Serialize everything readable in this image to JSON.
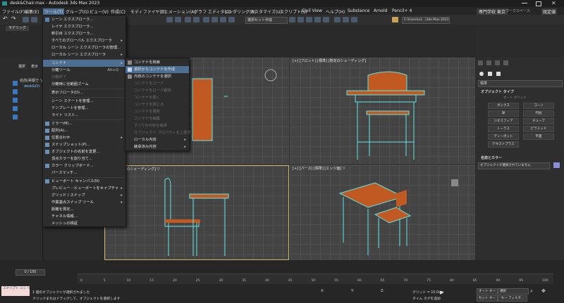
{
  "window": {
    "title": "desk&Chair.max - Autodesk 3ds Max 2023"
  },
  "menubar": {
    "items": [
      "ファイル(F)",
      "編集(E)",
      "ツール(T)",
      "グループ(G)",
      "ビュー(V)",
      "作成(C)",
      "モディファイヤ(O)",
      "アニメーション(A)",
      "グラフ エディタ(D)",
      "レンダリング(R)",
      "カスタマイズ(U)",
      "スクリプト(S)",
      "Civil View",
      "ヘルプ(H)",
      "Substance",
      "Arnold",
      "Pencil+ 4"
    ],
    "workspace": "専門学校 東京",
    "workspace_label": "ワークスペース:",
    "workspace_value": "既定値"
  },
  "toolbar": {
    "select_set": "選択セット作成",
    "path": "C:\\Users\\u1...\\3ds Max 2023"
  },
  "tools_menu": {
    "items": [
      {
        "label": "シーン エクスプローラ...",
        "enabled": true
      },
      {
        "label": "レイヤ エクスプローラ...",
        "enabled": true
      },
      {
        "label": "新引目 エクスプローラ...",
        "enabled": true
      },
      {
        "label": "すべてのグローバル エクスプローラ",
        "enabled": true,
        "submenu": true
      },
      {
        "label": "ローカル シーン エクスプローラの管理...",
        "enabled": true
      },
      {
        "label": "ローカル シーン エクスプローラ",
        "enabled": true,
        "submenu": true
      },
      {
        "label": "コンテナ",
        "enabled": true,
        "submenu": true,
        "highlight": true
      },
      {
        "label": "分離ツール",
        "enabled": true,
        "shortcut": "Alt+Q"
      },
      {
        "label": "分離終了",
        "enabled": false
      },
      {
        "label": "分離時に全範囲ズーム",
        "enabled": true
      },
      {
        "label": "表示フロータ(D)...",
        "enabled": true
      },
      {
        "label": "シーン ステートを管理...",
        "enabled": true
      },
      {
        "label": "テンプレートを管理...",
        "enabled": true
      },
      {
        "label": "ライト リスト...",
        "enabled": true
      },
      {
        "label": "ミラー(M)...",
        "enabled": true
      },
      {
        "label": "配列(A)...",
        "enabled": true
      },
      {
        "label": "位置合わせ",
        "enabled": true,
        "submenu": true
      },
      {
        "label": "スナップショット(P)...",
        "enabled": true
      },
      {
        "label": "オブジェクトの名前を変更...",
        "enabled": true
      },
      {
        "label": "頂点カラーを割り当て...",
        "enabled": true
      },
      {
        "label": "カラー クリップボード...",
        "enabled": true
      },
      {
        "label": "パースマッチ...",
        "enabled": true
      },
      {
        "label": "ビューポート キャンバス(N)",
        "enabled": true
      },
      {
        "label": "プレビュー - ビューポートをキャプチャ",
        "enabled": true,
        "submenu": true
      },
      {
        "label": "グリッド / スナップ",
        "enabled": true,
        "submenu": true
      },
      {
        "label": "作業基点スナップ ツール",
        "enabled": true,
        "submenu": true
      },
      {
        "label": "距離を測定...",
        "enabled": true
      },
      {
        "label": "チャネル情報...",
        "enabled": true
      },
      {
        "label": "メッシュの検証",
        "enabled": true
      }
    ]
  },
  "container_submenu": {
    "items": [
      {
        "label": "コンテナを検索",
        "enabled": true
      },
      {
        "label": "選択からコンテナを作成",
        "enabled": true,
        "highlight": true
      },
      {
        "label": "内容のコンテナを選択",
        "enabled": true
      },
      {
        "label": "コンテナをロード",
        "enabled": false
      },
      {
        "label": "コンテナをロード解除",
        "enabled": false
      },
      {
        "label": "コンテナを開く",
        "enabled": false
      },
      {
        "label": "コンテナを閉じる",
        "enabled": false
      },
      {
        "label": "コンテナを更新",
        "enabled": false
      },
      {
        "label": "コンテナを編集",
        "enabled": false
      },
      {
        "label": "すべての内容を継承",
        "enabled": false
      },
      {
        "label": "オブジェクト プロパティを上書き",
        "enabled": false
      },
      {
        "label": "ローカル内容",
        "enabled": true,
        "submenu": true
      },
      {
        "label": "継承済み内容",
        "enabled": true,
        "submenu": true
      }
    ]
  },
  "viewports": {
    "top_right": "[+] [フロント] [標準] [既定のシェーディング]",
    "bottom_left": "[標準] [既定のシェーディング] ▽",
    "bottom_right": "[+] [パース] [標準] [エッジ面] ▽"
  },
  "left_panel": {
    "tabs": [
      "選択",
      "表示"
    ],
    "header": "名前(昇順で ソ",
    "item": "desk&Ch",
    "modeling": "モデリング"
  },
  "command_panel": {
    "dropdown": "標準",
    "section_object_type": "オブジェクト タイプ",
    "autogrid": "オート グリッド",
    "buttons": [
      "ボックス",
      "コーン",
      "球",
      "円柱",
      "ジオスフィア",
      "チューブ",
      "トーラス",
      "ピラミッド",
      "ティーポット",
      "平面",
      "テキストプラス"
    ],
    "section_name_color": "名前とカラー",
    "name_value": "オブジェクトが選択されていません"
  },
  "statusbar": {
    "message1": "1 個のオブジェクトが選択されました",
    "message2": "クリックまたはドラッグして、オブジェクトを選択します",
    "script_label": "スクリプト ミニ リス",
    "frame_counter": "0 / 100",
    "grid": "グリッド = 10.0cm",
    "add_time_tag": "タイム タグを追加",
    "autokey": "オート キー",
    "set_key": "セット キー",
    "selection": "選択",
    "key_filters": "キー フィルタ...",
    "x_label": "X:",
    "y_label": "Y:",
    "z_label": "Z:"
  },
  "timeline": {
    "ticks": [
      "0",
      "5",
      "10",
      "15",
      "20",
      "25",
      "30",
      "35",
      "40",
      "45",
      "50",
      "55",
      "60",
      "65",
      "70",
      "75",
      "80",
      "85",
      "90",
      "95",
      "100"
    ]
  }
}
